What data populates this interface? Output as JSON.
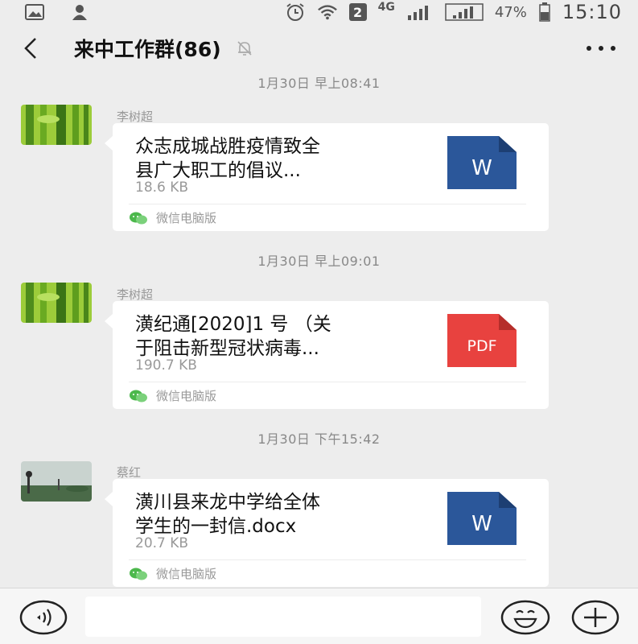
{
  "status_bar": {
    "sim_slot": "2",
    "network": "4G",
    "battery": "47%",
    "time": "15:10"
  },
  "header": {
    "title": "来中工作群(86)",
    "back_icon": "chevron-left-icon",
    "mute_icon": "bell-off-icon",
    "more_icon": "more-dots-icon"
  },
  "messages": [
    {
      "timestamp": "1月30日 早上08:41",
      "sender": "李树超",
      "file_name_lines": [
        "众志成城战胜疫情致全",
        "县广大职工的倡议..."
      ],
      "file_size": "18.6 KB",
      "file_type": "W",
      "file_color": "#2b579a",
      "source": "微信电脑版"
    },
    {
      "timestamp": "1月30日 早上09:01",
      "sender": "李树超",
      "file_name_lines": [
        "潢纪通[2020]1 号 （关",
        "于阻击新型冠状病毒..."
      ],
      "file_size": "190.7 KB",
      "file_type": "PDF",
      "file_color": "#e8423f",
      "source": "微信电脑版"
    },
    {
      "timestamp": "1月30日 下午15:42",
      "sender": "蔡红",
      "file_name_lines": [
        "潢川县来龙中学给全体",
        "学生的一封信.docx"
      ],
      "file_size": "20.7 KB",
      "file_type": "W",
      "file_color": "#2b579a",
      "source": "微信电脑版"
    }
  ],
  "input_bar": {
    "voice_icon": "voice-icon",
    "input_placeholder": "",
    "emoji_icon": "emoji-icon",
    "plus_icon": "plus-icon"
  },
  "colors": {
    "background": "#ededed",
    "card": "#ffffff",
    "word_blue": "#2b579a",
    "pdf_red": "#e8423f",
    "wechat_green": "#07c160"
  }
}
